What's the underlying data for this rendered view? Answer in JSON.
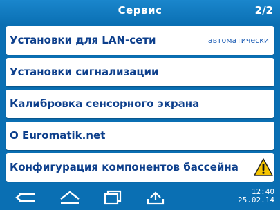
{
  "header": {
    "title": "Сервис",
    "page": "2/2"
  },
  "menu": {
    "items": [
      {
        "label": "Установки для LAN-сети",
        "value": "автоматически"
      },
      {
        "label": "Установки сигнализации"
      },
      {
        "label": "Калибровка сенсорного экрана"
      },
      {
        "label": "О Euromatik.net"
      },
      {
        "label": "Конфигурация компонентов бассейна",
        "icon": "warning-icon"
      }
    ]
  },
  "footer": {
    "icons": [
      "back-icon",
      "home-icon",
      "windows-icon",
      "eject-icon"
    ],
    "time": "12:40",
    "date": "25.02.14"
  },
  "colors": {
    "background": "#0a6fb3",
    "item_text": "#0d3f8c",
    "warning_fill": "#f5c400"
  }
}
